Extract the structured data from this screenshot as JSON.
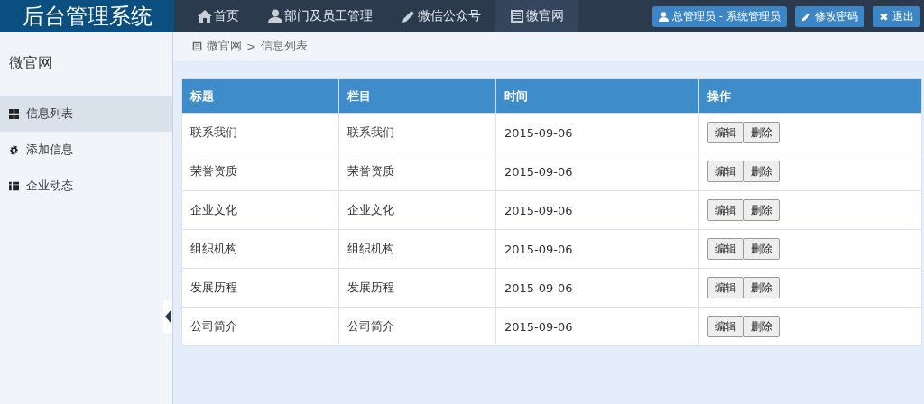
{
  "app_title": "后台管理系统",
  "nav": [
    {
      "label": "首页",
      "selected": false
    },
    {
      "label": "部门及员工管理",
      "selected": false
    },
    {
      "label": "微信公众号",
      "selected": false
    },
    {
      "label": "微官网",
      "selected": true
    }
  ],
  "header_buttons": [
    "总管理员 - 系统管理员",
    "修改密码",
    "退出"
  ],
  "sidebar": {
    "title": "微官网",
    "items": [
      {
        "label": "信息列表",
        "selected": true
      },
      {
        "label": "添加信息",
        "selected": false
      },
      {
        "label": "企业动态",
        "selected": false
      }
    ]
  },
  "breadcrumb": [
    "微官网",
    ">",
    "信息列表"
  ],
  "table": {
    "columns": [
      "标题",
      "栏目",
      "时间",
      "操作"
    ],
    "rows": [
      {
        "cells": [
          "联系我们",
          "联系我们",
          "2015-09-06"
        ],
        "actions": [
          "编辑",
          "删除"
        ]
      },
      {
        "cells": [
          "荣誉资质",
          "荣誉资质",
          "2015-09-06"
        ],
        "actions": [
          "编辑",
          "删除"
        ]
      },
      {
        "cells": [
          "企业文化",
          "企业文化",
          "2015-09-06"
        ],
        "actions": [
          "编辑",
          "删除"
        ]
      },
      {
        "cells": [
          "组织机构",
          "组织机构",
          "2015-09-06"
        ],
        "actions": [
          "编辑",
          "删除"
        ]
      },
      {
        "cells": [
          "发展历程",
          "发展历程",
          "2015-09-06"
        ],
        "actions": [
          "编辑",
          "删除"
        ]
      },
      {
        "cells": [
          "公司简介",
          "公司简介",
          "2015-09-06"
        ],
        "actions": [
          "编辑",
          "删除"
        ]
      }
    ]
  }
}
